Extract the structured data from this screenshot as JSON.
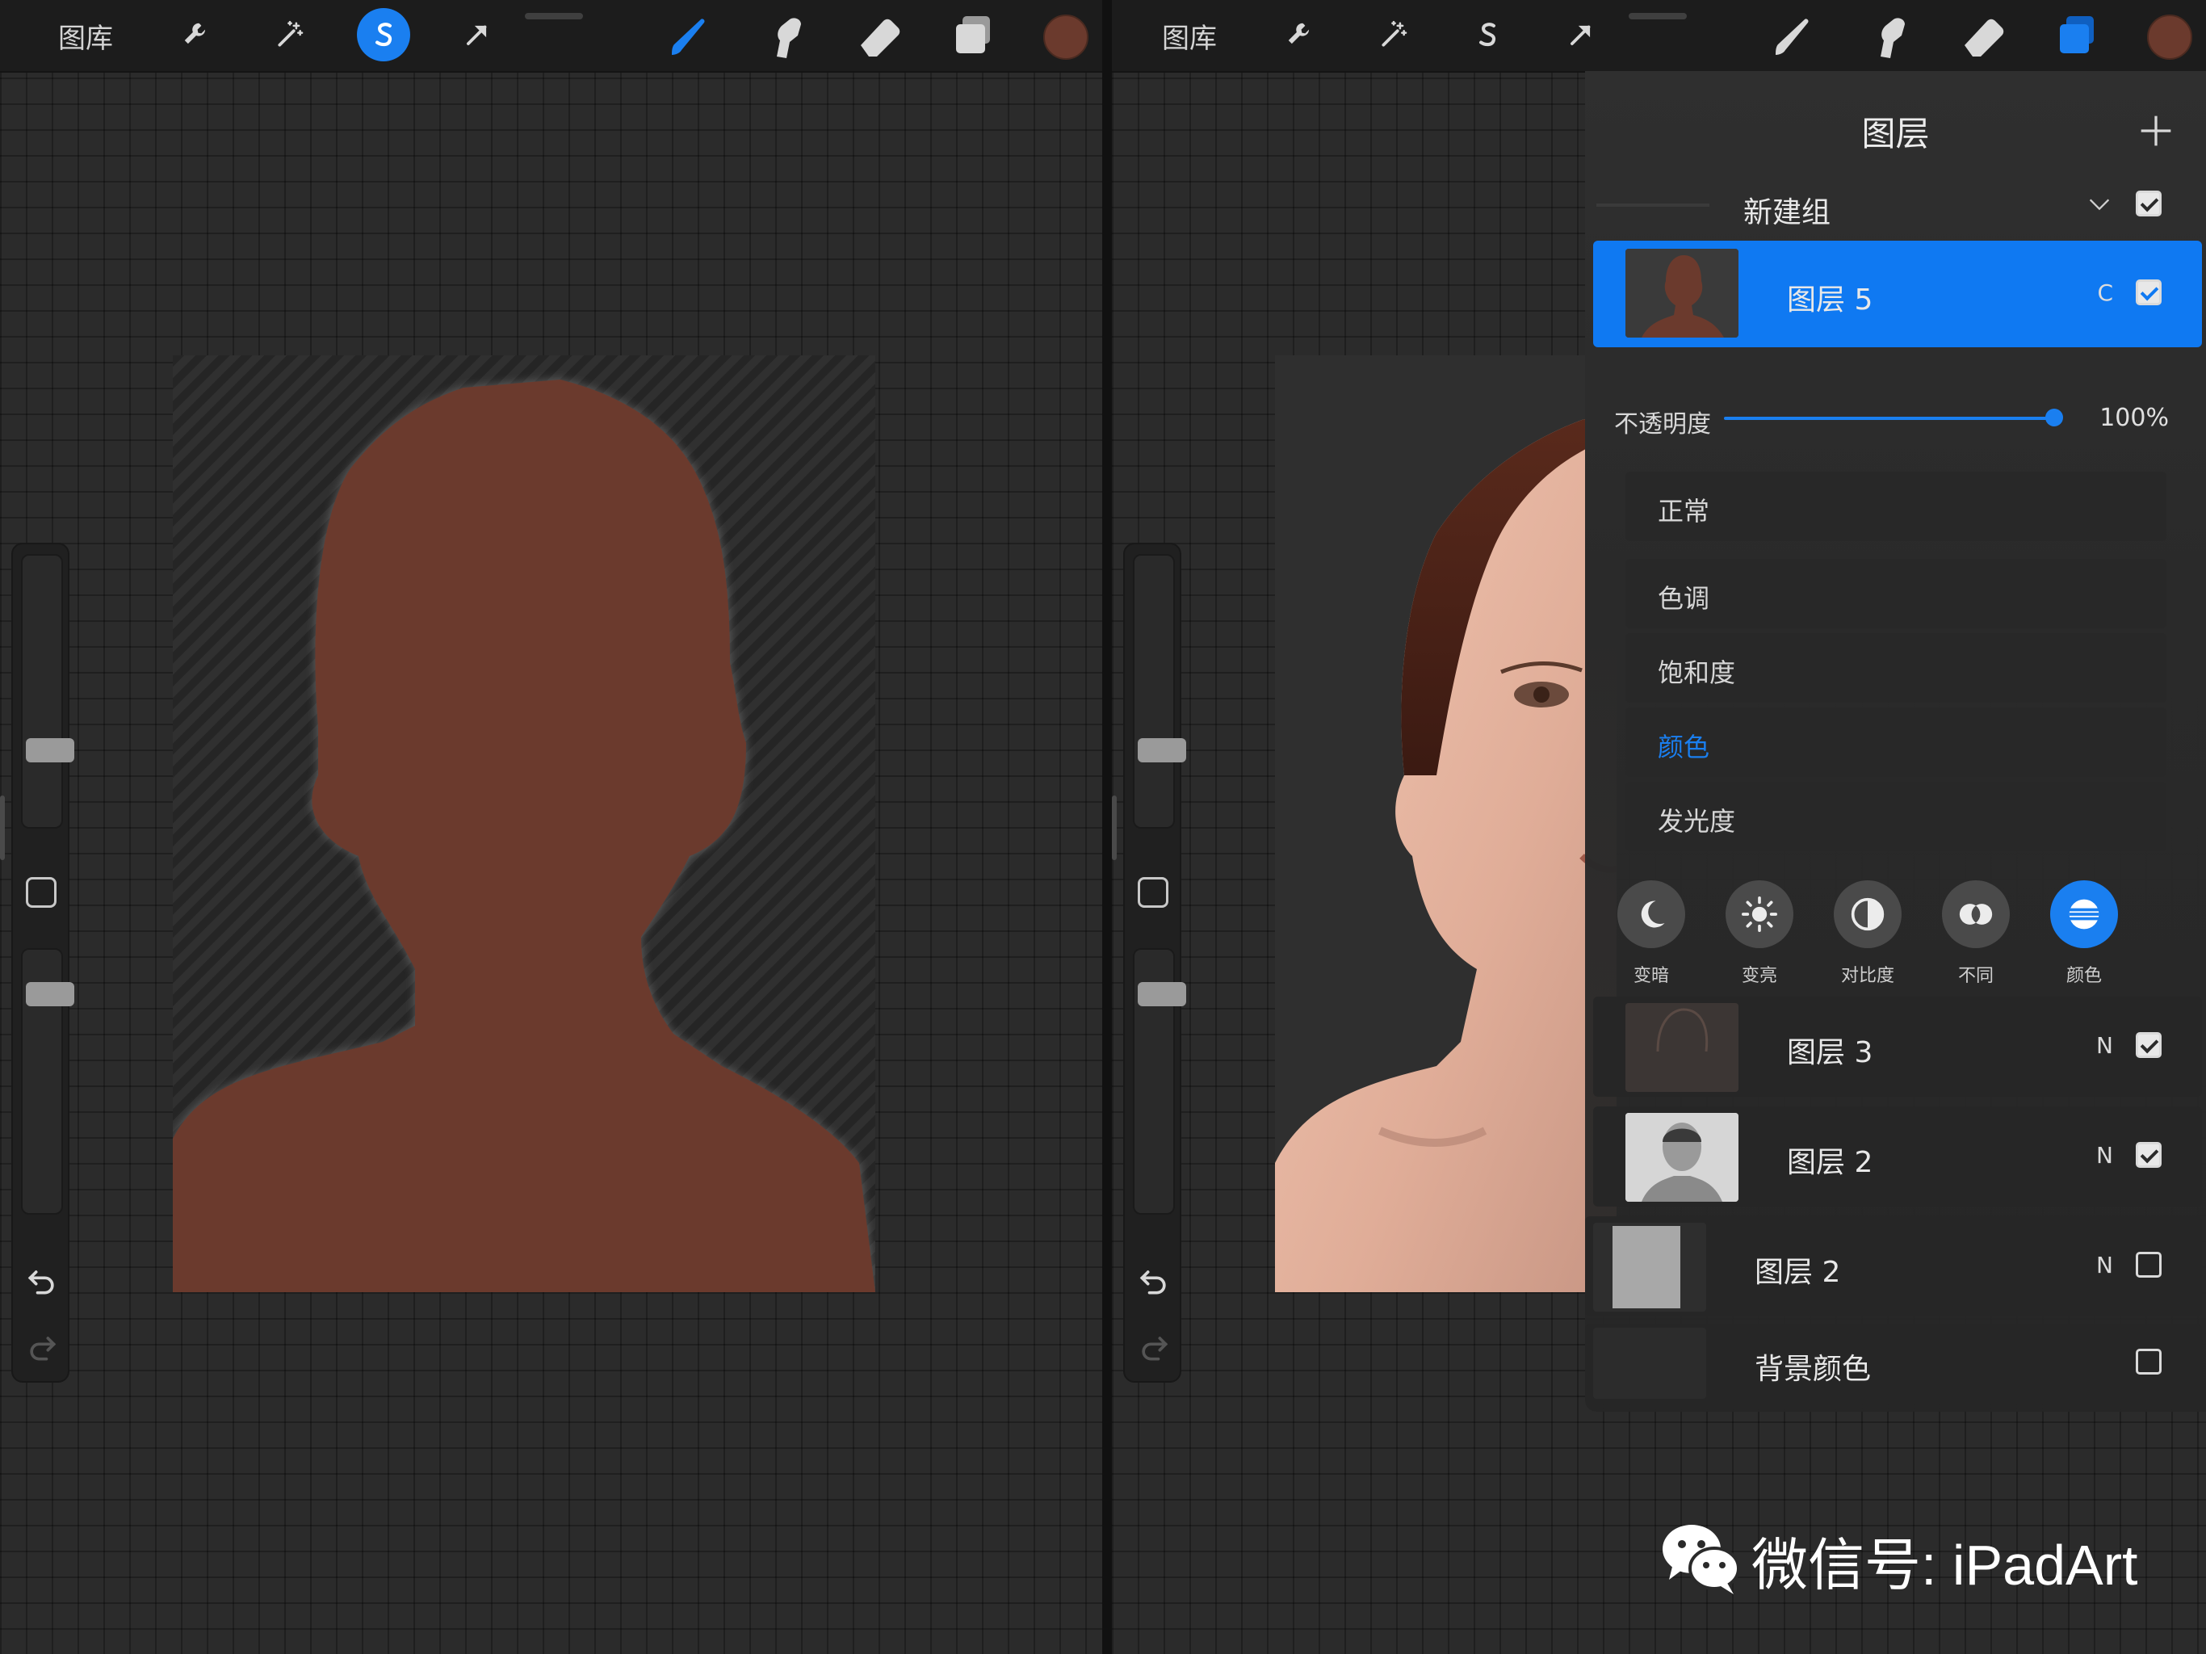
{
  "colors": {
    "accent": "#1a7ff0",
    "swatch": "#6b3a2d",
    "silhouette": "#6b3a2d"
  },
  "left": {
    "gallery_label": "图库",
    "toolbar_icons": [
      "wrench-icon",
      "magic-wand-icon",
      "selection-s-icon",
      "transform-arrow-icon",
      "brush-icon",
      "smudge-icon",
      "eraser-icon",
      "layers-icon"
    ]
  },
  "right": {
    "gallery_label": "图库",
    "layers_panel": {
      "title": "图层",
      "group_name": "新建组",
      "layers": [
        {
          "name": "图层 5",
          "mode": "C",
          "checked": true,
          "active": true
        },
        {
          "name": "图层 3",
          "mode": "N",
          "checked": true
        },
        {
          "name": "图层 2",
          "mode": "N",
          "checked": true
        },
        {
          "name": "图层 2",
          "mode": "N",
          "checked": false
        }
      ],
      "background_layer": {
        "name": "背景颜色",
        "checked": false
      },
      "opacity_label": "不透明度",
      "opacity_value": "100%",
      "opacity_fraction": 1.0,
      "blend_modes": [
        "正常",
        "色调",
        "饱和度",
        "颜色",
        "发光度"
      ],
      "active_blend_mode": "颜色",
      "blend_categories": [
        "变暗",
        "变亮",
        "对比度",
        "不同",
        "颜色"
      ],
      "active_blend_category": "颜色"
    }
  },
  "watermark": {
    "text": "微信号: iPadArt",
    "icon": "wechat-icon"
  }
}
